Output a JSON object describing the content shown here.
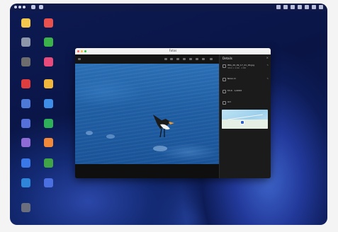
{
  "window": {
    "title": "Fotos"
  },
  "panel": {
    "title": "Details",
    "close_glyph": "×",
    "rows": [
      {
        "icon": "image-icon",
        "text": "IMG_20_09_17_21_29.jpg",
        "sub": "3840 × 2160 · 4 MB"
      },
      {
        "icon": "camera-icon",
        "text": "Nikon D"
      },
      {
        "icon": "lens-icon",
        "text": "f/5.6 · 1/2000"
      },
      {
        "icon": "location-icon",
        "text": "Ort"
      }
    ]
  },
  "desktop_icons": [
    {
      "color": "#f2c94c"
    },
    {
      "color": "#e9514f"
    },
    {
      "color": "#8d97a9"
    },
    {
      "color": "#3bb34a"
    },
    {
      "color": "#6d6d6d"
    },
    {
      "color": "#e64b7b"
    },
    {
      "color": "#e03e3e"
    },
    {
      "color": "#f0b73c"
    },
    {
      "color": "#4d7ad6"
    },
    {
      "color": "#3e8ee8"
    },
    {
      "color": "#5571d9"
    },
    {
      "color": "#2fb15a"
    },
    {
      "color": "#8f6bd6"
    },
    {
      "color": "#f08a3a"
    },
    {
      "color": "#3a78e8"
    },
    {
      "color": "#3fa547"
    },
    {
      "color": "#2f86d8"
    },
    {
      "color": "#4a6fe0"
    },
    {
      "color": "#6b6f7d"
    }
  ]
}
